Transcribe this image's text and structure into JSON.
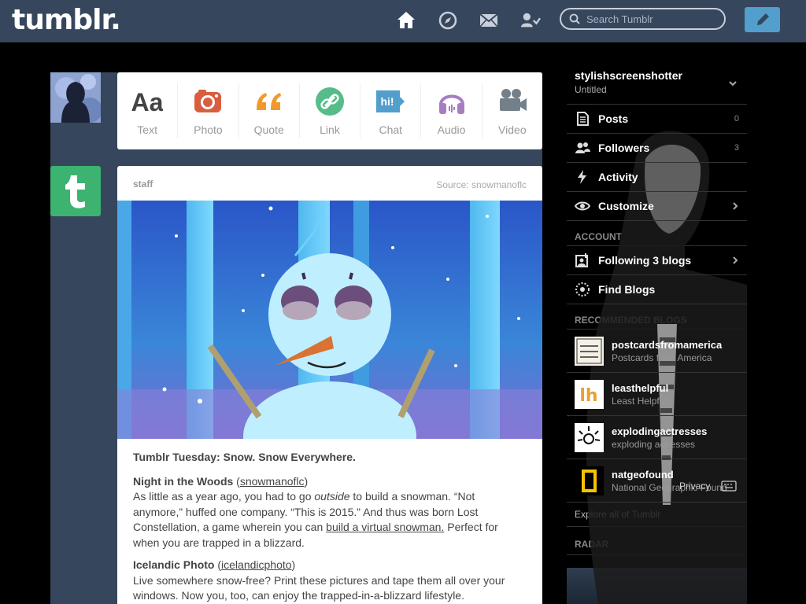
{
  "header": {
    "logo": "tumblr.",
    "search_placeholder": "Search Tumblr"
  },
  "post_types": [
    {
      "label": "Text",
      "icon": "text-icon",
      "color": "#444444"
    },
    {
      "label": "Photo",
      "icon": "camera-icon",
      "color": "#d95e40"
    },
    {
      "label": "Quote",
      "icon": "quote-icon",
      "color": "#f2992e"
    },
    {
      "label": "Link",
      "icon": "link-icon",
      "color": "#56bc8a"
    },
    {
      "label": "Chat",
      "icon": "chat-icon",
      "color": "#529ecc"
    },
    {
      "label": "Audio",
      "icon": "headphones-icon",
      "color": "#a77dc2"
    },
    {
      "label": "Video",
      "icon": "video-icon",
      "color": "#748089"
    }
  ],
  "post": {
    "user": "staff",
    "source": "Source: snowmanoflc",
    "title": "Tumblr Tuesday: Snow. Snow Everywhere.",
    "s1_title": "Night in the Woods",
    "s1_open": " (",
    "s1_link": "snowmanoflc",
    "s1_close": ")",
    "s1_t1": "As little as a year ago, you had to go ",
    "s1_em": "outside",
    "s1_t2": " to build a snowman. “Not anymore,” huffed one company. “This is 2015.” And thus was born Lost Constellation, a game wherein you can ",
    "s1_link2": "build a virtual snowman.",
    "s1_t3": " Perfect for when you are trapped in a blizzard.",
    "s2_title": "Icelandic Photo",
    "s2_open": " (",
    "s2_link": "icelandicphoto",
    "s2_close": ")",
    "s2_text": "Live somewhere snow-free? Print these pictures and tape them all over your windows. Now you, too, can enjoy the trapped-in-a-blizzard lifestyle."
  },
  "sidebar": {
    "blog_name": "stylishscreenshotter",
    "blog_sub": "Untitled",
    "rows": [
      {
        "label": "Posts",
        "count": "0",
        "icon": "posts-icon"
      },
      {
        "label": "Followers",
        "count": "3",
        "icon": "followers-icon"
      },
      {
        "label": "Activity",
        "count": "",
        "icon": "activity-icon"
      },
      {
        "label": "Customize",
        "count": "",
        "icon": "eye-icon"
      }
    ],
    "account_label": "ACCOUNT",
    "account_rows": [
      {
        "label": "Following 3 blogs",
        "icon": "following-icon"
      },
      {
        "label": "Find Blogs",
        "icon": "find-blogs-icon"
      }
    ],
    "recommended_label": "RECOMMENDED BLOGS",
    "recommended": [
      {
        "name": "postcardsfromamerica",
        "title": "Postcards from America"
      },
      {
        "name": "leasthelpful",
        "title": "Least Helpful"
      },
      {
        "name": "explodingactresses",
        "title": "exploding actresses"
      },
      {
        "name": "natgeofound",
        "title": "National Geographic Found"
      }
    ],
    "explore": "Explore all of Tumblr",
    "radar_label": "RADAR",
    "privacy": "Privacy"
  }
}
